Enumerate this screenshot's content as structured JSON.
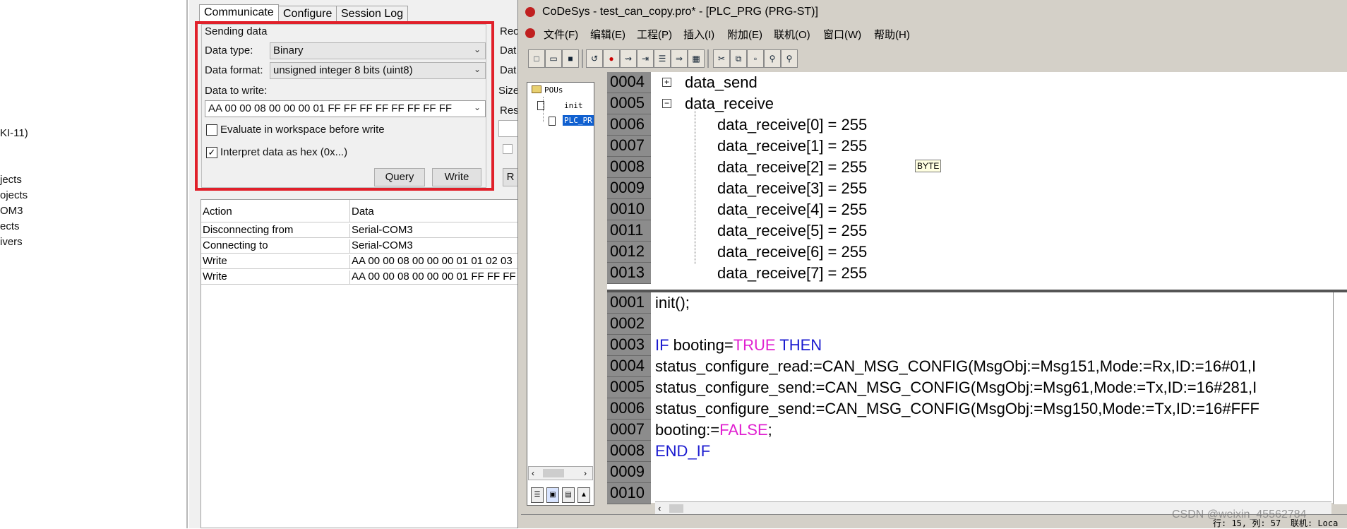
{
  "left_tree": {
    "fragments": [
      "KI-11)",
      "jects",
      "ojects",
      "OM3",
      "ects",
      "ivers"
    ]
  },
  "comm_tool": {
    "tabs": [
      "Communicate",
      "Configure",
      "Session Log"
    ],
    "sending_group_title": "Sending data",
    "data_type_label": "Data type:",
    "data_type_value": "Binary",
    "data_format_label": "Data format:",
    "data_format_value": "unsigned integer 8 bits (uint8)",
    "data_to_write_label": "Data to write:",
    "data_to_write_value": "AA 00 00 08 00 00 00 01 FF FF FF FF FF FF FF FF",
    "evaluate_label": "Evaluate in workspace before write",
    "evaluate_checked": false,
    "interpret_hex_label": "Interpret data as hex (0x...)",
    "interpret_hex_checked": true,
    "query_button": "Query",
    "write_button": "Write",
    "receive_fragments": [
      "Rec",
      "Dat",
      "Dat",
      "Size",
      "Res",
      "R"
    ],
    "log_headers": [
      "Action",
      "Data"
    ],
    "log_rows": [
      {
        "action": "Disconnecting from",
        "data": "Serial-COM3"
      },
      {
        "action": "Connecting to",
        "data": "Serial-COM3"
      },
      {
        "action": "Write",
        "data": "AA 00 00 08 00 00 00 01 01 02 03"
      },
      {
        "action": "Write",
        "data": "AA 00 00 08 00 00 00 01 FF FF FF"
      }
    ]
  },
  "codesys": {
    "title": "CoDeSys - test_can_copy.pro* - [PLC_PRG (PRG-ST)]",
    "menu": [
      "文件(F)",
      "编辑(E)",
      "工程(P)",
      "插入(I)",
      "附加(E)",
      "联机(O)",
      "窗口(W)",
      "帮助(H)"
    ],
    "pou_root": "POUs",
    "pou_items": [
      "init",
      "PLC_PR"
    ],
    "decl_lines": [
      {
        "num": "0004",
        "text": "data_send",
        "expander": "+"
      },
      {
        "num": "0005",
        "text": "data_receive",
        "expander": "−"
      },
      {
        "num": "0006",
        "text": "data_receive[0] = 255"
      },
      {
        "num": "0007",
        "text": "data_receive[1] = 255"
      },
      {
        "num": "0008",
        "text": "data_receive[2] = 255"
      },
      {
        "num": "0009",
        "text": "data_receive[3] = 255"
      },
      {
        "num": "0010",
        "text": "data_receive[4] = 255"
      },
      {
        "num": "0011",
        "text": "data_receive[5] = 255"
      },
      {
        "num": "0012",
        "text": "data_receive[6] = 255"
      },
      {
        "num": "0013",
        "text": "data_receive[7] = 255"
      }
    ],
    "tooltip": "BYTE",
    "impl_lines": [
      {
        "num": "0001",
        "segments": [
          {
            "t": "init();",
            "c": ""
          }
        ]
      },
      {
        "num": "0002",
        "segments": []
      },
      {
        "num": "0003",
        "segments": [
          {
            "t": "IF ",
            "c": "kw"
          },
          {
            "t": "booting=",
            "c": ""
          },
          {
            "t": "TRUE",
            "c": "bool"
          },
          {
            "t": " THEN",
            "c": "kw"
          }
        ]
      },
      {
        "num": "0004",
        "segments": [
          {
            "t": "status_configure_read:=CAN_MSG_CONFIG(MsgObj:=Msg151,Mode:=Rx,ID:=16#01,I",
            "c": ""
          }
        ]
      },
      {
        "num": "0005",
        "segments": [
          {
            "t": "status_configure_send:=CAN_MSG_CONFIG(MsgObj:=Msg61,Mode:=Tx,ID:=16#281,I",
            "c": ""
          }
        ]
      },
      {
        "num": "0006",
        "segments": [
          {
            "t": "status_configure_send:=CAN_MSG_CONFIG(MsgObj:=Msg150,Mode:=Tx,ID:=16#FFF",
            "c": ""
          }
        ]
      },
      {
        "num": "0007",
        "segments": [
          {
            "t": "booting:=",
            "c": ""
          },
          {
            "t": "FALSE",
            "c": "bool"
          },
          {
            "t": ";",
            "c": ""
          }
        ]
      },
      {
        "num": "0008",
        "segments": [
          {
            "t": "END_IF",
            "c": "kw"
          }
        ]
      },
      {
        "num": "0009",
        "segments": []
      },
      {
        "num": "0010",
        "segments": []
      }
    ],
    "status_text": "行: 15, 列: 57",
    "status_mode": "联机: Loca"
  },
  "watermark": "CSDN @weixin_45562784",
  "colors": {
    "highlight_red": "#e0202a",
    "keyword_blue": "#1a1ad0",
    "boolean_magenta": "#e020d0",
    "line_number_gray": "#8c8c8c"
  }
}
